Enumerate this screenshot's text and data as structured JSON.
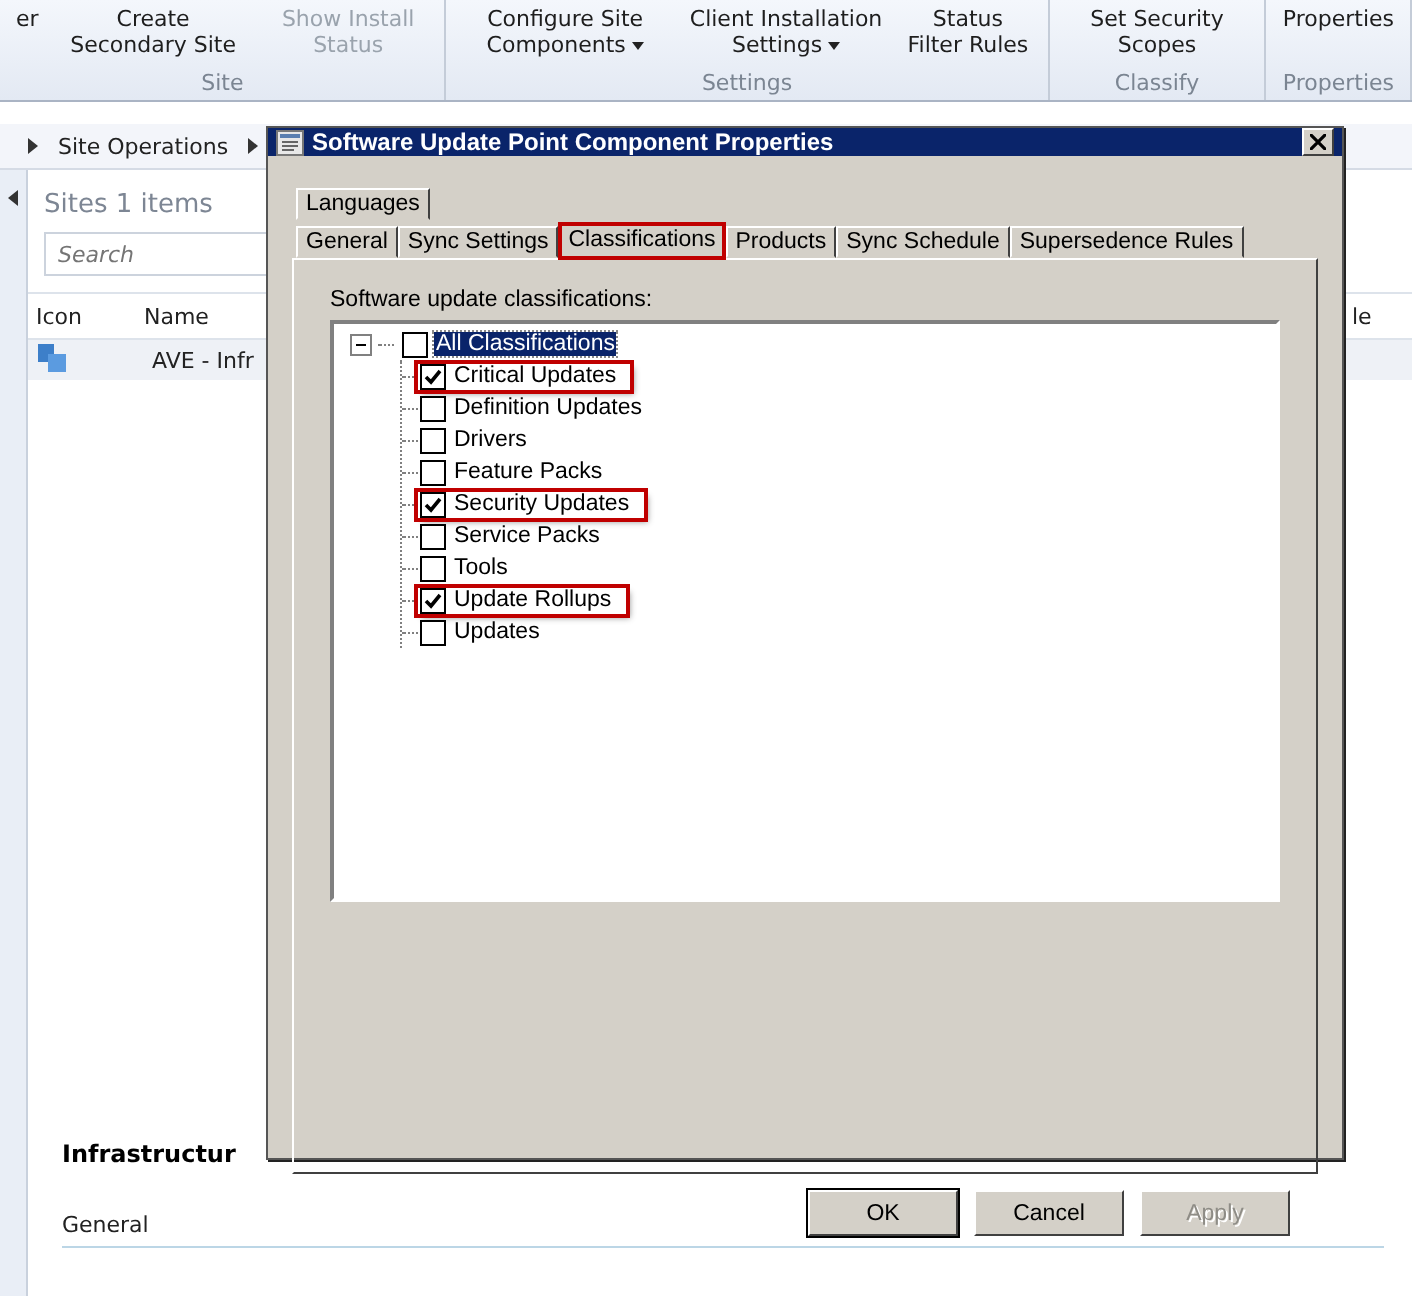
{
  "ribbon": {
    "groups": [
      {
        "label": "Site",
        "buttons": [
          {
            "label": "er",
            "disabled": false,
            "dropdown": false
          },
          {
            "label": "Create Secondary Site",
            "disabled": false,
            "dropdown": false
          },
          {
            "label": "Show Install Status",
            "disabled": true,
            "dropdown": false
          }
        ]
      },
      {
        "label": "Settings",
        "buttons": [
          {
            "label": "Configure Site Components",
            "disabled": false,
            "dropdown": true
          },
          {
            "label": "Client Installation Settings",
            "disabled": false,
            "dropdown": true
          },
          {
            "label": "Status Filter Rules",
            "disabled": false,
            "dropdown": false
          }
        ]
      },
      {
        "label": "Classify",
        "buttons": [
          {
            "label": "Set Security Scopes",
            "disabled": false,
            "dropdown": false
          }
        ]
      },
      {
        "label": "Properties",
        "buttons": [
          {
            "label": "Properties",
            "disabled": false,
            "dropdown": false
          }
        ]
      }
    ]
  },
  "breadcrumb": [
    "Site Operations"
  ],
  "list": {
    "title": "Sites 1 items",
    "search": {
      "placeholder": "Search"
    },
    "columns": [
      "Icon",
      "Name"
    ],
    "rows": [
      {
        "name": "AVE - Infr"
      }
    ],
    "column_3": "le"
  },
  "details": {
    "title": "Infrastructur",
    "section": "General"
  },
  "dialog": {
    "title": "Software Update Point Component Properties",
    "tab_rows": [
      [
        {
          "label": "Languages",
          "selected": false,
          "annotated": false
        }
      ],
      [
        {
          "label": "General",
          "selected": false,
          "annotated": false
        },
        {
          "label": "Sync Settings",
          "selected": false,
          "annotated": false
        },
        {
          "label": "Classifications",
          "selected": true,
          "annotated": true
        },
        {
          "label": "Products",
          "selected": false,
          "annotated": false
        },
        {
          "label": "Sync Schedule",
          "selected": false,
          "annotated": false
        },
        {
          "label": "Supersedence Rules",
          "selected": false,
          "annotated": false
        }
      ]
    ],
    "tree_label": "Software update classifications:",
    "tree": [
      {
        "label": "All Classifications",
        "checked": false,
        "selected": true,
        "expanded": true,
        "annotated": false,
        "children": [
          {
            "label": "Critical Updates",
            "checked": true,
            "selected": false,
            "annotated": true
          },
          {
            "label": "Definition Updates",
            "checked": false,
            "selected": false,
            "annotated": false
          },
          {
            "label": "Drivers",
            "checked": false,
            "selected": false,
            "annotated": false
          },
          {
            "label": "Feature Packs",
            "checked": false,
            "selected": false,
            "annotated": false
          },
          {
            "label": "Security Updates",
            "checked": true,
            "selected": false,
            "annotated": true
          },
          {
            "label": "Service Packs",
            "checked": false,
            "selected": false,
            "annotated": false
          },
          {
            "label": "Tools",
            "checked": false,
            "selected": false,
            "annotated": false
          },
          {
            "label": "Update Rollups",
            "checked": true,
            "selected": false,
            "annotated": true
          },
          {
            "label": "Updates",
            "checked": false,
            "selected": false,
            "annotated": false
          }
        ]
      }
    ],
    "buttons": [
      {
        "label": "OK",
        "disabled": false,
        "default": true
      },
      {
        "label": "Cancel",
        "disabled": false,
        "default": false
      },
      {
        "label": "Apply",
        "disabled": true,
        "default": false
      }
    ]
  }
}
